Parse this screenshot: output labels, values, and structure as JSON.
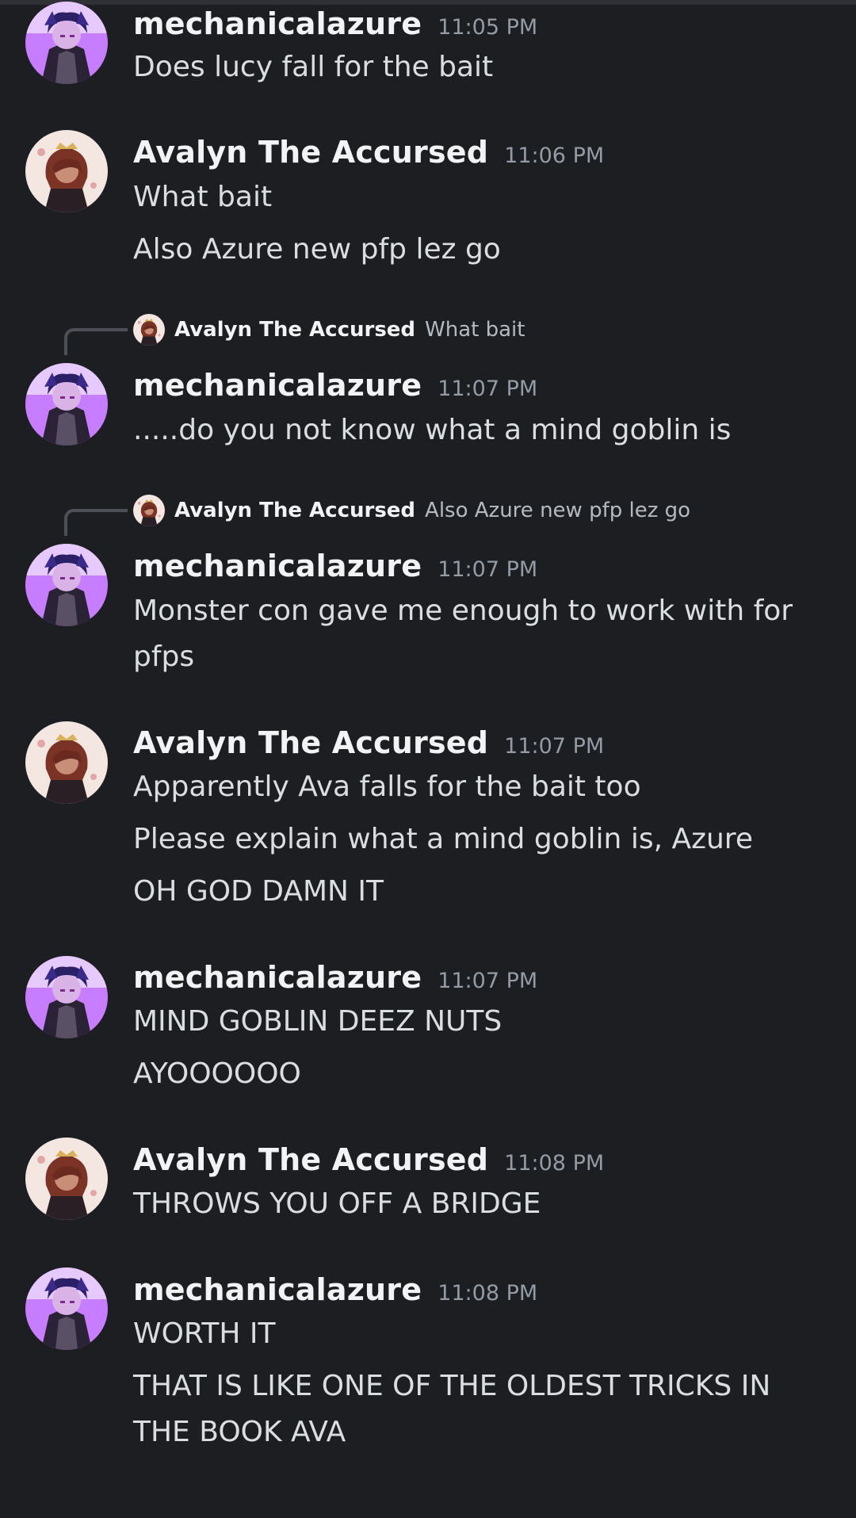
{
  "users": {
    "azure": {
      "name": "mechanicalazure",
      "avatar_icon": "azure-avatar-icon",
      "avatar_bg": "#c77dff"
    },
    "avalyn": {
      "name": "Avalyn The Accursed",
      "avatar_icon": "avalyn-avatar-icon",
      "avatar_bg": "#f4e6e1"
    }
  },
  "colors": {
    "background": "#1d1e22",
    "username": "#f2f3f5",
    "timestamp": "#949ba4",
    "text": "#dbdee1"
  },
  "messages": [
    {
      "author": "mechanicalazure",
      "time": "11:05 PM",
      "lines": [
        "Does lucy fall for the bait"
      ]
    },
    {
      "author": "Avalyn The Accursed",
      "time": "11:06 PM",
      "lines": [
        "What bait",
        "Also Azure new pfp lez go"
      ]
    },
    {
      "author": "mechanicalazure",
      "time": "11:07 PM",
      "reply": {
        "name": "Avalyn The Accursed",
        "text": "What bait"
      },
      "lines": [
        ".....do you not know what a mind goblin is"
      ]
    },
    {
      "author": "mechanicalazure",
      "time": "11:07 PM",
      "reply": {
        "name": "Avalyn The Accursed",
        "text": "Also Azure new pfp lez go"
      },
      "lines": [
        "Monster con gave me enough to work with for",
        "pfps"
      ]
    },
    {
      "author": "Avalyn The Accursed",
      "time": "11:07 PM",
      "lines": [
        "Apparently Ava falls for the bait too",
        "Please explain what a mind goblin is, Azure",
        "OH GOD DAMN IT"
      ]
    },
    {
      "author": "mechanicalazure",
      "time": "11:07 PM",
      "lines": [
        "MIND GOBLIN DEEZ NUTS",
        "AYOOOOOO"
      ]
    },
    {
      "author": "Avalyn The Accursed",
      "time": "11:08 PM",
      "lines": [
        "THROWS YOU OFF A BRIDGE"
      ]
    },
    {
      "author": "mechanicalazure",
      "time": "11:08 PM",
      "lines": [
        "WORTH IT",
        "THAT IS LIKE ONE OF THE OLDEST TRICKS IN",
        "THE BOOK AVA"
      ]
    }
  ]
}
